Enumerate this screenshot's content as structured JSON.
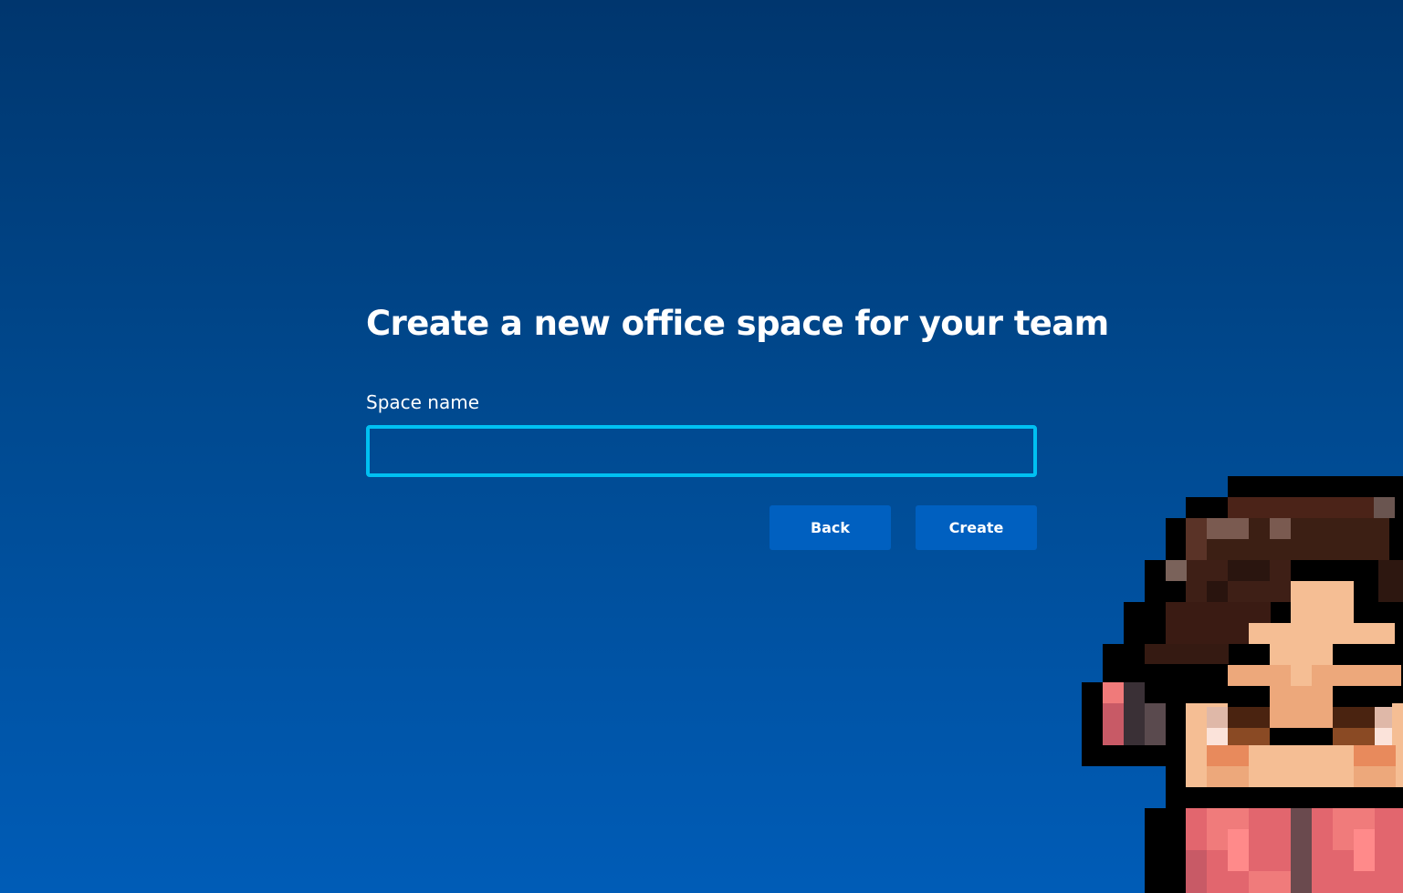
{
  "main": {
    "title": "Create a new office space for your team",
    "space_name_label": "Space name",
    "space_name_value": "",
    "space_name_placeholder": ""
  },
  "actions": {
    "back_label": "Back",
    "create_label": "Create"
  },
  "colors": {
    "background_top": "#00366e",
    "background_bottom": "#005cb7",
    "input_border": "#00c0f2",
    "button_bg": "#0060c0",
    "text": "#ffffff"
  },
  "decoration": {
    "avatar_icon": "pixel-character-avatar-icon"
  }
}
